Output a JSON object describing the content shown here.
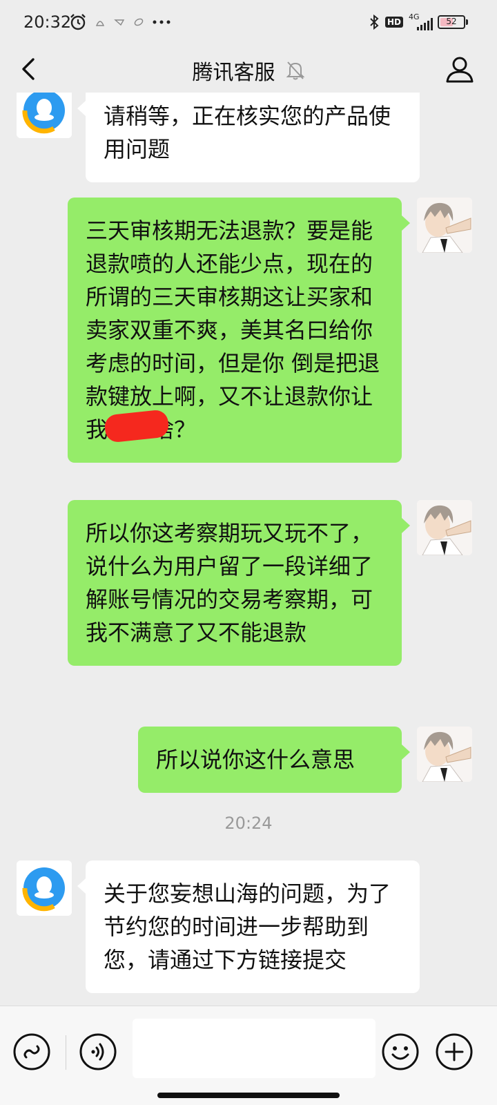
{
  "status_bar": {
    "time": "20:32",
    "network": "4G",
    "hd": "HD",
    "battery": "52",
    "icons": [
      "alarm-icon",
      "notification-icon",
      "notification-icon",
      "notification-icon",
      "more-dots-icon",
      "bluetooth-icon",
      "signal-icon",
      "battery-icon"
    ]
  },
  "header": {
    "title": "腾讯客服",
    "icons": [
      "back-icon",
      "mute-bell-icon",
      "person-icon"
    ]
  },
  "chat": {
    "timestamp": "20:24",
    "messages": [
      {
        "sender": "agent",
        "text": "请稍等，正在核实您的产品使用问题"
      },
      {
        "sender": "me",
        "text": "三天审核期无法退款？要是能退款喷的人还能少点，现在的所谓的三天审核期这让买家和卖家双重不爽，美其名曰给你考虑的时间，但是你    倒是把退款键放上啊，又不让退款你让我考虑啥？"
      },
      {
        "sender": "me",
        "text": "所以你这考察期玩又玩不了，说什么为用户留了一段详细了解账号情况的交易考察期，可我不满意了又不能退款"
      },
      {
        "sender": "me",
        "text": "所以说你这什么意思"
      },
      {
        "sender": "agent",
        "text": "关于您妄想山海的问题，为了节约您的时间进一步帮助到您，请通过下方链接提交"
      }
    ]
  },
  "input_bar": {
    "value": "",
    "icons": [
      "mini-program-icon",
      "voice-icon",
      "emoji-icon",
      "plus-icon"
    ]
  },
  "colors": {
    "background": "#ededed",
    "outgoing_bubble": "#95ec69",
    "incoming_bubble": "#ffffff",
    "timestamp": "#999999"
  }
}
